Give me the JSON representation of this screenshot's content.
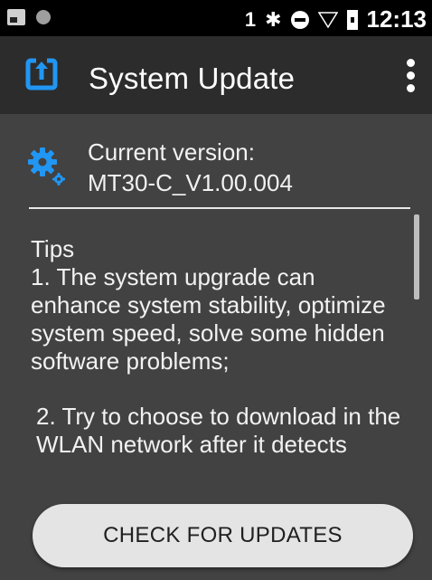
{
  "status_bar": {
    "sim": "1",
    "time": "12:13",
    "icons": [
      "image-icon",
      "circle-icon",
      "bluetooth-icon",
      "do-not-disturb-icon",
      "wifi-icon",
      "battery-icon"
    ]
  },
  "app_bar": {
    "title": "System Update",
    "icon": "system-update-icon",
    "menu_icon": "more-vertical-icon",
    "background": "#2c2c2c"
  },
  "version": {
    "label": "Current version:",
    "value": "MT30-C_V1.00.004",
    "icon": "gear-icon"
  },
  "tips": {
    "heading": "Tips",
    "item1": "1. The system upgrade can enhance system stability, optimize system speed, solve some hidden software problems;",
    "item2": "2. Try to choose to download in the WLAN network after it detects"
  },
  "actions": {
    "check_label": "CHECK FOR UPDATES"
  },
  "colors": {
    "background": "#424242",
    "accent_icon": "#2196f3",
    "button": "#e4e4e4"
  }
}
